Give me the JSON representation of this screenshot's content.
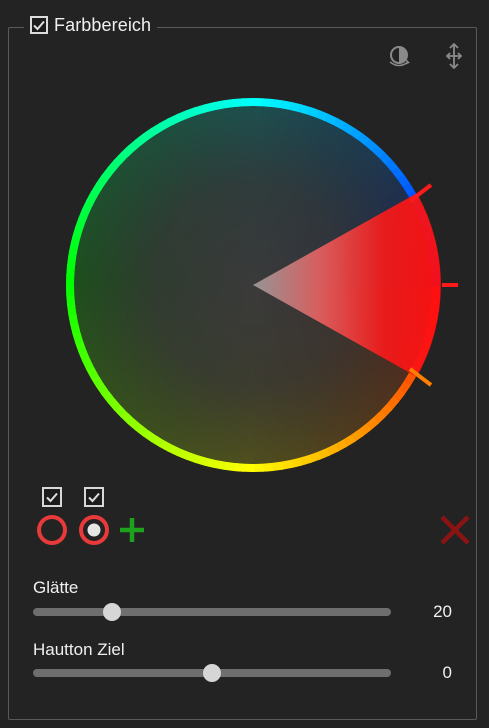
{
  "panel": {
    "title": "Farbbereich",
    "enabled": true
  },
  "toolbar": {
    "icons": [
      "contrast-rotate-icon",
      "move-arrows-icon"
    ]
  },
  "color_wheel": {
    "selected_hue_center_deg": 0,
    "selected_hue_width_deg": 56,
    "accent": "#ff1a1a"
  },
  "ranges": [
    {
      "enabled": true,
      "active": false
    },
    {
      "enabled": true,
      "active": true
    }
  ],
  "buttons": {
    "add": "+",
    "delete": "×"
  },
  "sliders": [
    {
      "label": "Glätte",
      "value": "20",
      "fraction": 0.22
    },
    {
      "label": "Hautton Ziel",
      "value": "0",
      "fraction": 0.5
    }
  ],
  "colors": {
    "background": "#232323",
    "border": "#5a5a5a",
    "ring_red": "#e83a3a",
    "add_green": "#1ea21e",
    "delete_red": "#8a1414"
  }
}
